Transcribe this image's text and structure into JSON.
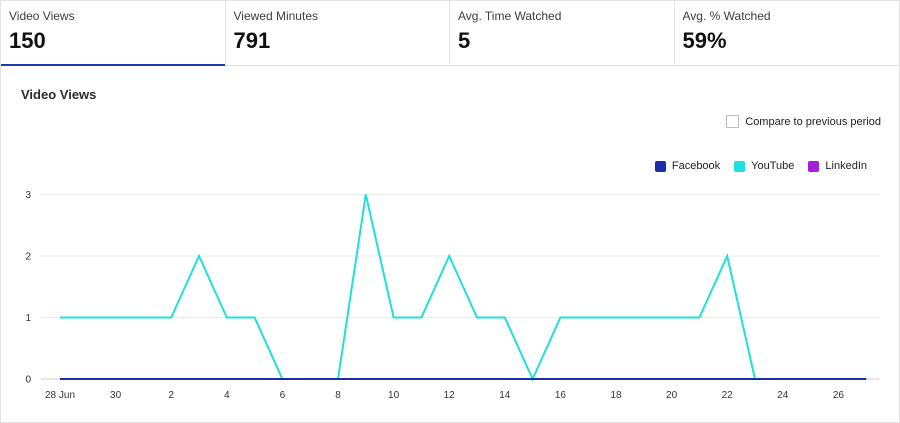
{
  "kpis": [
    {
      "label": "Video Views",
      "value": "150",
      "active": true
    },
    {
      "label": "Viewed Minutes",
      "value": "791",
      "active": false
    },
    {
      "label": "Avg. Time Watched",
      "value": "5",
      "active": false
    },
    {
      "label": "Avg. % Watched",
      "value": "59%",
      "active": false
    }
  ],
  "panel": {
    "title": "Video Views",
    "compare_label": "Compare to previous period",
    "compare_checked": false
  },
  "legend": [
    {
      "name": "Facebook",
      "color": "#1a2ea8"
    },
    {
      "name": "YouTube",
      "color": "#1fe0dc"
    },
    {
      "name": "LinkedIn",
      "color": "#a61fd8"
    }
  ],
  "chart_data": {
    "type": "line",
    "x_tick_labels": [
      "28 Jun",
      "30",
      "2",
      "4",
      "6",
      "8",
      "10",
      "12",
      "14",
      "16",
      "18",
      "20",
      "22",
      "24",
      "26"
    ],
    "y_ticks": [
      0,
      1,
      2,
      3
    ],
    "ylim": [
      0,
      3
    ],
    "x": [
      "28 Jun",
      "29 Jun",
      "30 Jun",
      "1 Jul",
      "2 Jul",
      "3 Jul",
      "4 Jul",
      "5 Jul",
      "6 Jul",
      "7 Jul",
      "8 Jul",
      "9 Jul",
      "10 Jul",
      "11 Jul",
      "12 Jul",
      "13 Jul",
      "14 Jul",
      "15 Jul",
      "16 Jul",
      "17 Jul",
      "18 Jul",
      "19 Jul",
      "20 Jul",
      "21 Jul",
      "22 Jul",
      "23 Jul",
      "24 Jul",
      "25 Jul",
      "26 Jul",
      "27 Jul"
    ],
    "series": [
      {
        "name": "Facebook",
        "color": "#1a2ea8",
        "values": [
          0,
          0,
          0,
          0,
          0,
          0,
          0,
          0,
          0,
          0,
          0,
          0,
          0,
          0,
          0,
          0,
          0,
          0,
          0,
          0,
          0,
          0,
          0,
          0,
          0,
          0,
          0,
          0,
          0,
          0
        ]
      },
      {
        "name": "YouTube",
        "color": "#1fe0dc",
        "values": [
          1,
          1,
          1,
          1,
          1,
          2,
          1,
          1,
          0,
          0,
          0,
          3,
          1,
          1,
          2,
          1,
          1,
          0,
          1,
          1,
          1,
          1,
          1,
          1,
          2,
          0,
          0,
          0,
          0,
          0
        ]
      },
      {
        "name": "LinkedIn",
        "color": "#a61fd8",
        "values": [
          0,
          0,
          0,
          0,
          0,
          0,
          0,
          0,
          0,
          0,
          0,
          0,
          0,
          0,
          0,
          0,
          0,
          0,
          0,
          0,
          0,
          0,
          0,
          0,
          0,
          0,
          0,
          0,
          0,
          0
        ]
      }
    ]
  }
}
